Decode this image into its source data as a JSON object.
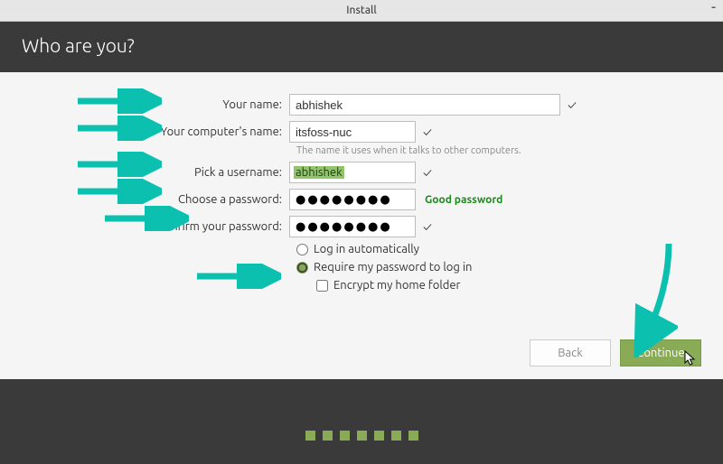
{
  "window": {
    "title": "Install"
  },
  "header": {
    "title": "Who are you?"
  },
  "form": {
    "name_label": "Your name:",
    "name_value": "abhishek",
    "computer_label": "Your computer's name:",
    "computer_value": "itsfoss-nuc",
    "computer_hint": "The name it uses when it talks to other computers.",
    "username_label": "Pick a username:",
    "username_value": "abhishek",
    "pw_label": "Choose a password:",
    "pw_value": "●●●●●●●●",
    "pw_strength": "Good password",
    "pw2_label": "Confirm your password:",
    "pw2_value": "●●●●●●●●",
    "auto_label": "Log in automatically",
    "req_label": "Require my password to log in",
    "encrypt_label": "Encrypt my home folder"
  },
  "buttons": {
    "back": "Back",
    "continue": "Continue"
  }
}
